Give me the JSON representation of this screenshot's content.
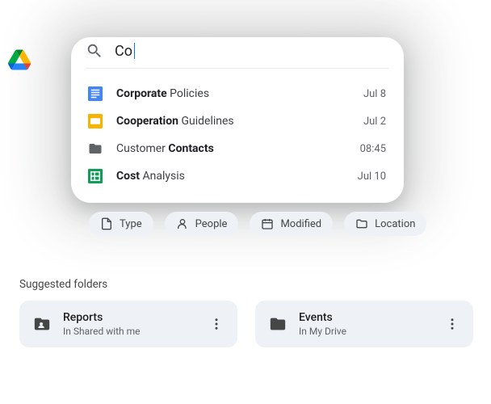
{
  "search": {
    "query": "Co"
  },
  "results": [
    {
      "icon": "docs",
      "before": "",
      "bold": "Co",
      "mid": "rporate",
      "rest": " Policies",
      "date": "Jul 8"
    },
    {
      "icon": "slides",
      "before": "",
      "bold": "Co",
      "mid": "operation",
      "rest": " Guidelines",
      "date": "Jul 2"
    },
    {
      "icon": "folder",
      "before": "Customer ",
      "bold": "Co",
      "mid": "ntacts",
      "rest": "",
      "date": "08:45"
    },
    {
      "icon": "sheets",
      "before": "",
      "bold": "Co",
      "mid": "st",
      "rest": " Analysis",
      "date": "Jul 10"
    }
  ],
  "chips": [
    {
      "icon": "type",
      "label": "Type"
    },
    {
      "icon": "people",
      "label": "People"
    },
    {
      "icon": "modified",
      "label": "Modified"
    },
    {
      "icon": "location",
      "label": "Location"
    }
  ],
  "suggested_label": "Suggested folders",
  "folders": [
    {
      "icon": "shared-folder",
      "title": "Reports",
      "subtitle": "In Shared with me"
    },
    {
      "icon": "folder",
      "title": "Events",
      "subtitle": "In My Drive"
    }
  ]
}
